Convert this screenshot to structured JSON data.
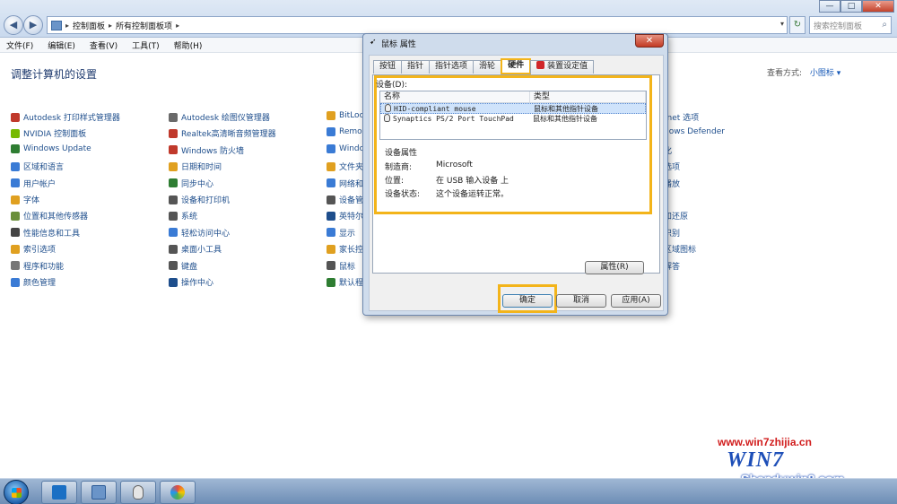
{
  "window": {
    "breadcrumb": [
      "控制面板",
      "所有控制面板项"
    ],
    "search_placeholder": "搜索控制面板",
    "controls": {
      "min": "—",
      "max": "□",
      "close": "✕"
    }
  },
  "menu": [
    "文件(F)",
    "编辑(E)",
    "查看(V)",
    "工具(T)",
    "帮助(H)"
  ],
  "main": {
    "title": "调整计算机的设置",
    "view_by_label": "查看方式:",
    "view_by_value": "小图标 ▾"
  },
  "columns": [
    {
      "items": [
        {
          "label": "Autodesk 打印样式管理器",
          "color": "#c0392b"
        },
        {
          "label": "NVIDIA 控制面板",
          "color": "#76b900"
        },
        {
          "label": "Windows Update",
          "color": "#2e7d32"
        },
        {
          "label": "区域和语言",
          "color": "#3a7bd5"
        },
        {
          "label": "用户帐户",
          "color": "#3a7bd5"
        },
        {
          "label": "字体",
          "color": "#e0a020"
        },
        {
          "label": "位置和其他传感器",
          "color": "#6a8f3a"
        },
        {
          "label": "性能信息和工具",
          "color": "#444444"
        },
        {
          "label": "索引选项",
          "color": "#e0a020"
        },
        {
          "label": "程序和功能",
          "color": "#777777"
        },
        {
          "label": "颜色管理",
          "color": "#3a7bd5"
        }
      ]
    },
    {
      "items": [
        {
          "label": "Autodesk 绘图仪管理器",
          "color": "#6a6a6a"
        },
        {
          "label": "Realtek高清晰音频管理器",
          "color": "#c0392b"
        },
        {
          "label": "Windows 防火墙",
          "color": "#c0392b"
        },
        {
          "label": "日期和时间",
          "color": "#e0a020"
        },
        {
          "label": "同步中心",
          "color": "#2e7d32"
        },
        {
          "label": "设备和打印机",
          "color": "#555555"
        },
        {
          "label": "系统",
          "color": "#555555"
        },
        {
          "label": "轻松访问中心",
          "color": "#3a7bd5"
        },
        {
          "label": "桌面小工具",
          "color": "#555555"
        },
        {
          "label": "键盘",
          "color": "#555555"
        },
        {
          "label": "操作中心",
          "color": "#1e4e8c"
        }
      ]
    },
    {
      "items": [
        {
          "label": "BitLoc",
          "color": "#e0a020"
        },
        {
          "label": "Remo",
          "color": "#3a7bd5"
        },
        {
          "label": "Windo",
          "color": "#3a7bd5"
        },
        {
          "label": "文件夹",
          "color": "#e0a020"
        },
        {
          "label": "网络和",
          "color": "#3a7bd5"
        },
        {
          "label": "设备管",
          "color": "#555555"
        },
        {
          "label": "英特尔",
          "color": "#1e4e8c"
        },
        {
          "label": "显示",
          "color": "#3a7bd5"
        },
        {
          "label": "家长控",
          "color": "#e0a020"
        },
        {
          "label": "鼠标",
          "color": "#555555"
        },
        {
          "label": "默认程",
          "color": "#2e7d32"
        }
      ]
    },
    {
      "items": [
        {
          "label": "rnet 选项",
          "color": "#3a7bd5"
        },
        {
          "label": "dows Defender",
          "color": "#555555"
        },
        {
          "label": "化",
          "color": "#555555"
        },
        {
          "label": "选项",
          "color": "#555555"
        },
        {
          "label": "播放",
          "color": "#555555"
        },
        {
          "label": "",
          "color": "#ffffff"
        },
        {
          "label": "和还原",
          "color": "#555555"
        },
        {
          "label": "识别",
          "color": "#555555"
        },
        {
          "label": "区域图标",
          "color": "#555555"
        },
        {
          "label": "解答",
          "color": "#555555"
        },
        {
          "label": "",
          "color": "#ffffff"
        }
      ]
    }
  ],
  "dialog": {
    "title": "鼠标 属性",
    "tabs": [
      "按钮",
      "指针",
      "指针选项",
      "滑轮",
      "硬件",
      "装置设定值"
    ],
    "active_tab": "硬件",
    "devices_label": "设备(D):",
    "list_headers": [
      "名称",
      "类型"
    ],
    "devices": [
      {
        "name": "HID-compliant mouse",
        "type": "鼠标和其他指针设备"
      },
      {
        "name": "Synaptics PS/2 Port TouchPad",
        "type": "鼠标和其他指针设备"
      }
    ],
    "props_title": "设备属性",
    "props": [
      {
        "label": "制造商:",
        "value": "Microsoft"
      },
      {
        "label": "位置:",
        "value": "在 USB 输入设备 上"
      },
      {
        "label": "设备状态:",
        "value": "这个设备运转正常。"
      }
    ],
    "properties_button": "属性(R)",
    "ok_button": "确定",
    "cancel_button": "取消",
    "apply_button": "应用(A)"
  },
  "watermark": {
    "site": "www.win7zhijia.cn",
    "logo": "WIN7",
    "sub": "Shenduwin8.com"
  }
}
